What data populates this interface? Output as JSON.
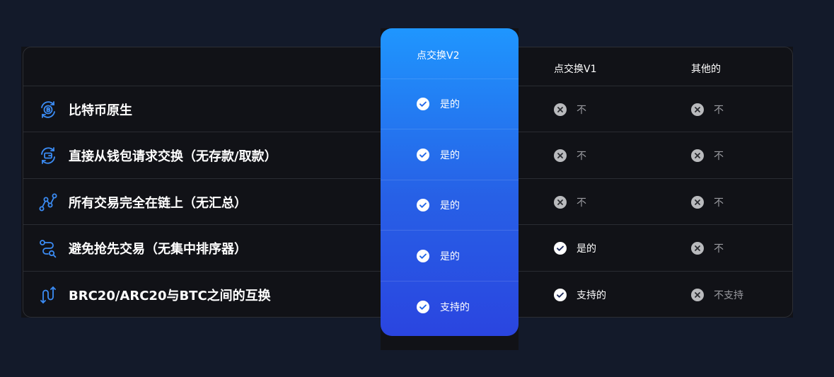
{
  "columns": {
    "v2": "点交换V2",
    "v1": "点交换V1",
    "other": "其他的"
  },
  "rows": [
    {
      "icon": "bitcoin-cycle-icon",
      "feature": "比特币原生",
      "v2": {
        "ok": true,
        "text": "是的"
      },
      "v1": {
        "ok": false,
        "text": "不"
      },
      "other": {
        "ok": false,
        "text": "不"
      }
    },
    {
      "icon": "wallet-swap-icon",
      "feature": "直接从钱包请求交换（无存款/取款）",
      "v2": {
        "ok": true,
        "text": "是的"
      },
      "v1": {
        "ok": false,
        "text": "不"
      },
      "other": {
        "ok": false,
        "text": "不"
      }
    },
    {
      "icon": "chain-nodes-icon",
      "feature": "所有交易完全在链上（无汇总）",
      "v2": {
        "ok": true,
        "text": "是的"
      },
      "v1": {
        "ok": false,
        "text": "不"
      },
      "other": {
        "ok": false,
        "text": "不"
      }
    },
    {
      "icon": "route-search-icon",
      "feature": "避免抢先交易（无集中排序器）",
      "v2": {
        "ok": true,
        "text": "是的"
      },
      "v1": {
        "ok": true,
        "text": "是的"
      },
      "other": {
        "ok": false,
        "text": "不"
      }
    },
    {
      "icon": "bidirectional-arrows-icon",
      "feature": "BRC20/ARC20与BTC之间的互换",
      "v2": {
        "ok": true,
        "text": "支持的"
      },
      "v1": {
        "ok": true,
        "text": "支持的"
      },
      "other": {
        "ok": false,
        "text": "不支持"
      }
    }
  ],
  "colors": {
    "accent_top": "#1f96fe",
    "accent_bottom": "#2a45e0",
    "icon_blue": "#3b8cf5",
    "no_mark": "#b9babd"
  }
}
